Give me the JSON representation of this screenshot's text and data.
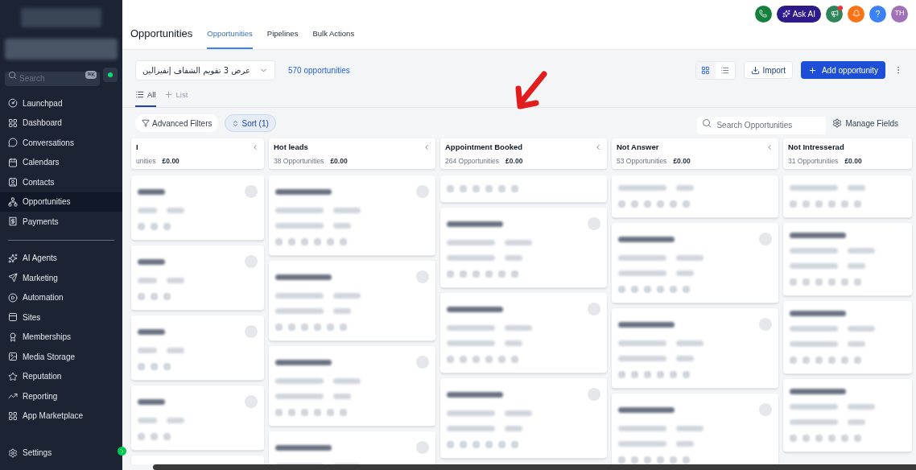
{
  "sidebar": {
    "search": {
      "placeholder": "Search",
      "shortcut": "⌘K"
    },
    "nav_groups": [
      {
        "items": [
          {
            "label": "Launchpad",
            "selected": false
          },
          {
            "label": "Dashboard",
            "selected": false
          },
          {
            "label": "Conversations",
            "selected": false
          },
          {
            "label": "Calendars",
            "selected": false
          },
          {
            "label": "Contacts",
            "selected": false
          },
          {
            "label": "Opportunities",
            "selected": true
          },
          {
            "label": "Payments",
            "selected": false
          }
        ]
      },
      {
        "items": [
          {
            "label": "AI Agents",
            "selected": false
          },
          {
            "label": "Marketing",
            "selected": false
          },
          {
            "label": "Automation",
            "selected": false
          },
          {
            "label": "Sites",
            "selected": false
          },
          {
            "label": "Memberships",
            "selected": false
          },
          {
            "label": "Media Storage",
            "selected": false
          },
          {
            "label": "Reputation",
            "selected": false
          },
          {
            "label": "Reporting",
            "selected": false
          },
          {
            "label": "App Marketplace",
            "selected": false
          }
        ]
      }
    ],
    "settings": "Settings"
  },
  "topbar": {
    "ask_ai": "Ask AI",
    "help": "?",
    "avatar": "TH",
    "notification_dot": true
  },
  "header": {
    "title": "Opportunities",
    "tabs": [
      {
        "label": "Opportunities",
        "selected": true
      },
      {
        "label": "Pipelines",
        "selected": false
      },
      {
        "label": "Bulk Actions",
        "selected": false
      }
    ]
  },
  "toolbar": {
    "pipeline": "عرض 3 تقويم الشفاف إنفيزالين",
    "count": "570 opportunities",
    "views": [
      {
        "kind": "grid",
        "selected": true
      },
      {
        "kind": "list",
        "selected": false
      }
    ],
    "import": "Import",
    "add": "Add opportunity"
  },
  "subtabs": [
    {
      "label": "All",
      "kind": "list",
      "selected": true
    },
    {
      "label": "List",
      "kind": "add",
      "selected": false
    }
  ],
  "filters": {
    "advanced": "Advanced Filters",
    "sort": "Sort (1)",
    "search_placeholder": "Search Opportunities",
    "manage": "Manage Fields"
  },
  "columns": [
    {
      "title": "I",
      "count": "unities",
      "amount": "£0.00",
      "collapsible": true,
      "cards": [
        {
          "kind": "cut"
        },
        {
          "kind": "cut"
        },
        {
          "kind": "cut"
        },
        {
          "kind": "cut"
        },
        {
          "kind": "cut"
        }
      ]
    },
    {
      "title": "Hot leads",
      "count": "38 Opportunities",
      "amount": "£0.00",
      "collapsible": true,
      "cards": [
        {
          "kind": "full"
        },
        {
          "kind": "full"
        },
        {
          "kind": "full"
        },
        {
          "kind": "full"
        }
      ]
    },
    {
      "title": "Appointment Booked",
      "count": "264 Opportunities",
      "amount": "£0.00",
      "collapsible": true,
      "cards": [
        {
          "kind": "icons"
        },
        {
          "kind": "full"
        },
        {
          "kind": "full"
        },
        {
          "kind": "full"
        }
      ]
    },
    {
      "title": "Not Answer",
      "count": "53 Opportunities",
      "amount": "£0.00",
      "collapsible": true,
      "cards": [
        {
          "kind": "tail"
        },
        {
          "kind": "full"
        },
        {
          "kind": "full"
        },
        {
          "kind": "full"
        }
      ]
    },
    {
      "title": "Not Intresserad",
      "count": "31 Opportunities",
      "amount": "£0.00",
      "collapsible": false,
      "cards": [
        {
          "kind": "tail"
        },
        {
          "kind": "plain"
        },
        {
          "kind": "plain"
        },
        {
          "kind": "plain"
        }
      ]
    }
  ]
}
